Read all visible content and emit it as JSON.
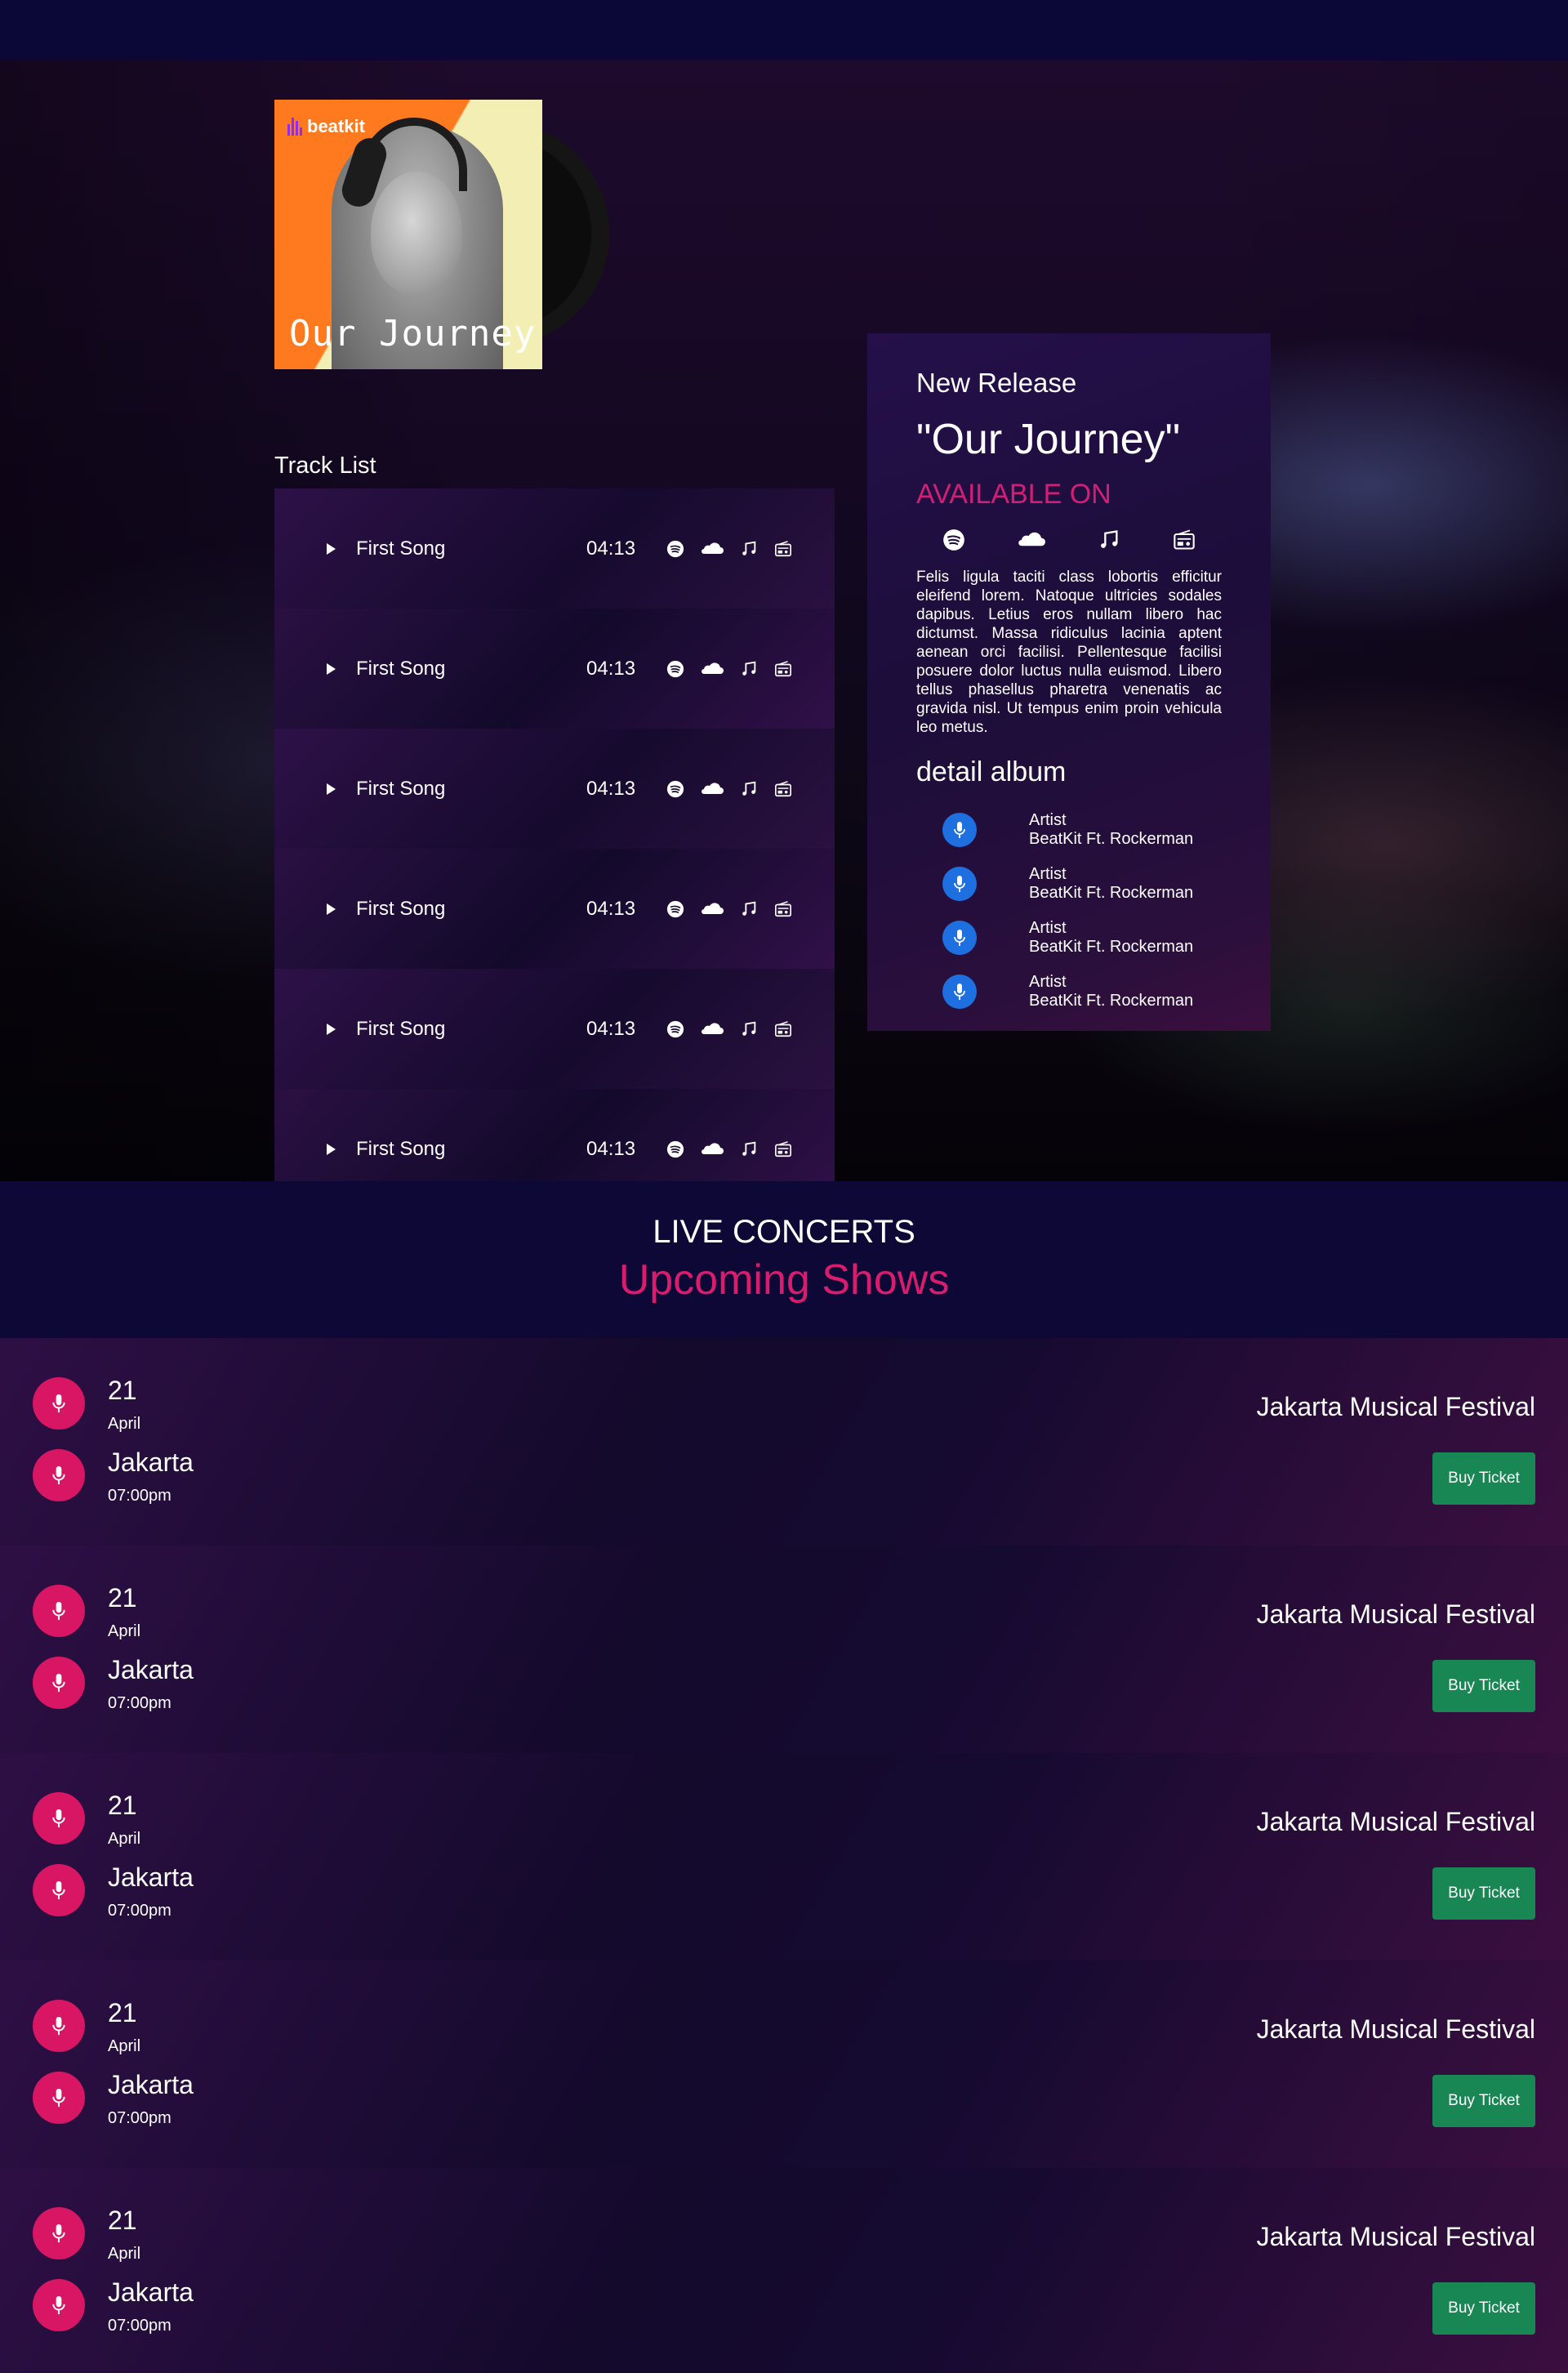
{
  "album": {
    "brand": "beatkit",
    "cover_title": "Our Journey"
  },
  "tracklist": {
    "heading": "Track List",
    "tracks": [
      {
        "name": "First Song",
        "duration": "04:13"
      },
      {
        "name": "First Song",
        "duration": "04:13"
      },
      {
        "name": "First Song",
        "duration": "04:13"
      },
      {
        "name": "First Song",
        "duration": "04:13"
      },
      {
        "name": "First Song",
        "duration": "04:13"
      },
      {
        "name": "First Song",
        "duration": "04:13"
      }
    ],
    "platform_icons": [
      "spotify-icon",
      "soundcloud-icon",
      "music-note-icon",
      "radio-icon"
    ]
  },
  "release": {
    "kicker": "New Release",
    "title": "\"Our Journey\"",
    "available": "AVAILABLE ON",
    "description": "Felis ligula taciti class lobortis efficitur eleifend lorem. Natoque ultricies sodales dapibus. Letius eros nullam libero hac dictumst. Massa ridiculus lacinia aptent aenean orci facilisi. Pellentesque facilisi posuere dolor luctus nulla euismod. Libero tellus phasellus pharetra venenatis ac gravida nisl. Ut tempus enim proin vehicula leo metus.",
    "detail_heading": "detail album",
    "artists": [
      {
        "label": "Artist",
        "value": "BeatKit Ft. Rockerman"
      },
      {
        "label": "Artist",
        "value": "BeatKit Ft. Rockerman"
      },
      {
        "label": "Artist",
        "value": "BeatKit Ft. Rockerman"
      },
      {
        "label": "Artist",
        "value": "BeatKit Ft. Rockerman"
      }
    ]
  },
  "concerts": {
    "kicker": "LIVE CONCERTS",
    "heading": "Upcoming Shows",
    "shows": [
      {
        "day": "21",
        "month": "April",
        "city": "Jakarta",
        "time": "07:00pm",
        "event": "Jakarta Musical Festival",
        "button": "Buy Ticket"
      },
      {
        "day": "21",
        "month": "April",
        "city": "Jakarta",
        "time": "07:00pm",
        "event": "Jakarta Musical Festival",
        "button": "Buy Ticket"
      },
      {
        "day": "21",
        "month": "April",
        "city": "Jakarta",
        "time": "07:00pm",
        "event": "Jakarta Musical Festival",
        "button": "Buy Ticket"
      },
      {
        "day": "21",
        "month": "April",
        "city": "Jakarta",
        "time": "07:00pm",
        "event": "Jakarta Musical Festival",
        "button": "Buy Ticket"
      },
      {
        "day": "21",
        "month": "April",
        "city": "Jakarta",
        "time": "07:00pm",
        "event": "Jakarta Musical Festival",
        "button": "Buy Ticket"
      }
    ]
  },
  "colors": {
    "accent_pink": "#d91c6e",
    "button_green": "#198754",
    "artist_icon_blue": "#1e6fe0"
  }
}
